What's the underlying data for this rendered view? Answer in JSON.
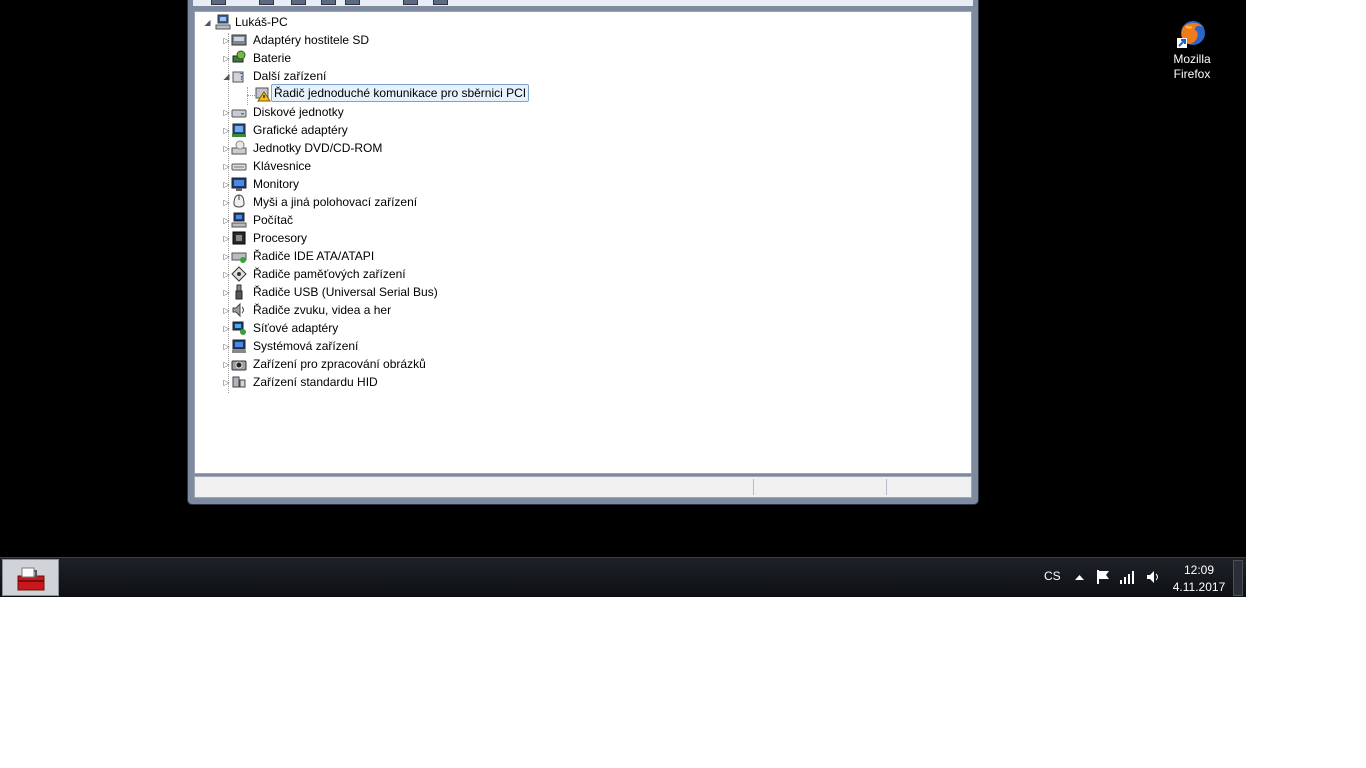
{
  "tree": {
    "root": "Lukáš-PC",
    "categories": [
      {
        "label": "Adaptéry hostitele SD",
        "icon": "sd-host-adapter-icon"
      },
      {
        "label": "Baterie",
        "icon": "battery-icon"
      },
      {
        "label": "Další zařízení",
        "icon": "unknown-device-icon",
        "expanded": true,
        "children": [
          {
            "label": "Řadič jednoduché komunikace pro sběrnici PCI",
            "icon": "warning-device-icon",
            "selected": true
          }
        ]
      },
      {
        "label": "Diskové jednotky",
        "icon": "disk-drive-icon"
      },
      {
        "label": "Grafické adaptéry",
        "icon": "display-adapter-icon"
      },
      {
        "label": "Jednotky DVD/CD-ROM",
        "icon": "dvd-drive-icon"
      },
      {
        "label": "Klávesnice",
        "icon": "keyboard-icon"
      },
      {
        "label": "Monitory",
        "icon": "monitor-icon"
      },
      {
        "label": "Myši a jiná polohovací zařízení",
        "icon": "mouse-icon"
      },
      {
        "label": "Počítač",
        "icon": "computer-icon"
      },
      {
        "label": "Procesory",
        "icon": "processor-icon"
      },
      {
        "label": "Řadiče IDE ATA/ATAPI",
        "icon": "ide-controller-icon"
      },
      {
        "label": "Řadiče paměťových zařízení",
        "icon": "storage-controller-icon"
      },
      {
        "label": "Řadiče USB (Universal Serial Bus)",
        "icon": "usb-icon"
      },
      {
        "label": "Řadiče zvuku, videa a her",
        "icon": "speaker-icon"
      },
      {
        "label": "Síťové adaptéry",
        "icon": "network-adapter-icon"
      },
      {
        "label": "Systémová zařízení",
        "icon": "system-device-icon"
      },
      {
        "label": "Zařízení pro zpracování obrázků",
        "icon": "camera-icon"
      },
      {
        "label": "Zařízení standardu HID",
        "icon": "hid-icon"
      }
    ]
  },
  "desktop": {
    "icons": [
      {
        "label_line1": "Mozilla",
        "label_line2": "Firefox",
        "icon": "firefox-icon"
      }
    ]
  },
  "taskbar": {
    "language": "CS",
    "tray_icons": [
      "show-hidden-icons-arrow",
      "action-center-flag-icon",
      "network-signal-icon",
      "volume-icon"
    ],
    "time": "12:09",
    "date": "4.11.2017",
    "pinned": [
      {
        "icon": "toolbox-icon"
      }
    ]
  },
  "colors": {
    "desktop": "#000000",
    "selection_bg": "#e6f1fc",
    "selection_border": "#7da2ce",
    "warning": "#f2c21b"
  }
}
